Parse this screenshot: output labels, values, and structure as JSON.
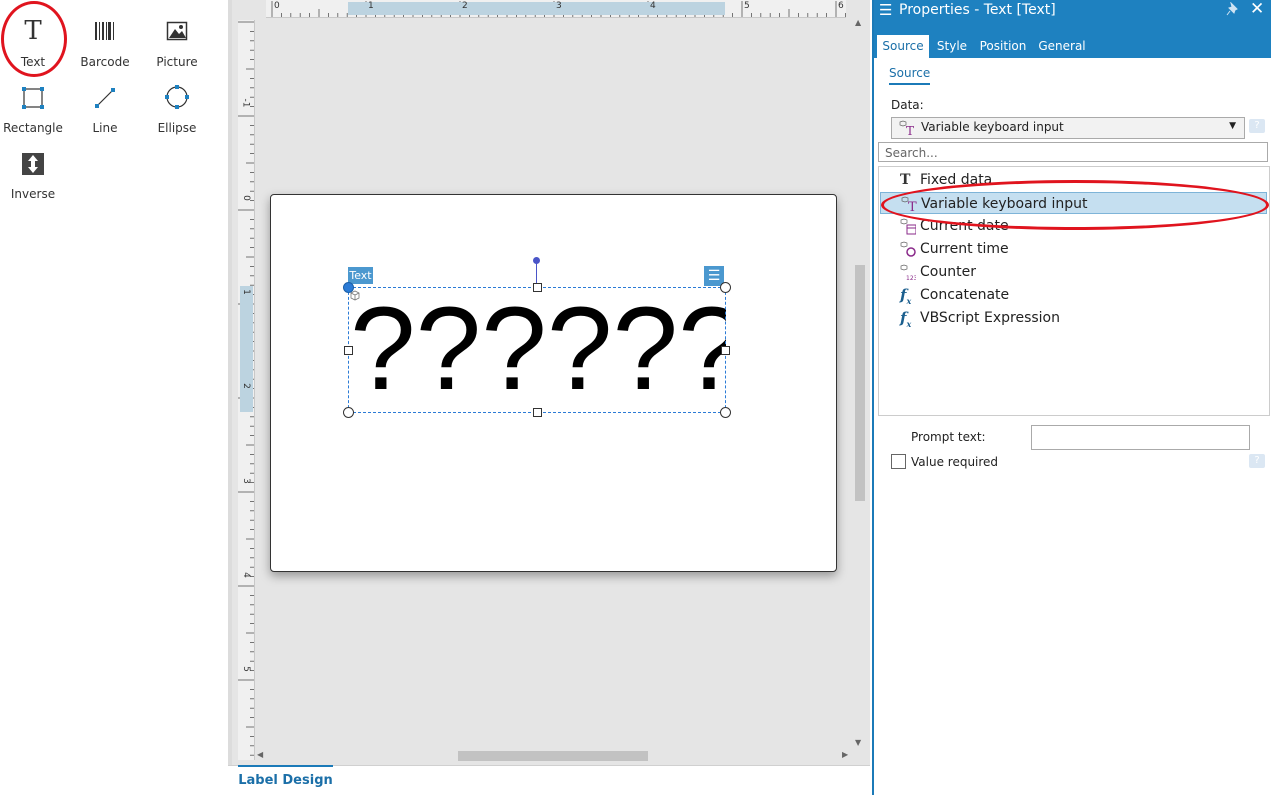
{
  "toolbox": {
    "tools": [
      {
        "label": "Text",
        "icon": "text-tool-icon"
      },
      {
        "label": "Barcode",
        "icon": "barcode-icon"
      },
      {
        "label": "Picture",
        "icon": "picture-icon"
      },
      {
        "label": "Rectangle",
        "icon": "rectangle-icon"
      },
      {
        "label": "Line",
        "icon": "line-icon"
      },
      {
        "label": "Ellipse",
        "icon": "ellipse-icon"
      },
      {
        "label": "Inverse",
        "icon": "inverse-icon"
      }
    ]
  },
  "rulers": {
    "horizontal": [
      "0",
      "1",
      "2",
      "3",
      "4",
      "5",
      "6"
    ],
    "vertical": [
      "-1",
      "0",
      "1",
      "2",
      "3",
      "4",
      "5"
    ]
  },
  "canvas": {
    "object_tag": "Text",
    "object_text": "??????",
    "menu_glyph": "☰"
  },
  "bottom_tab": "Label Design",
  "properties": {
    "title": "Properties - Text [Text]",
    "tabs": [
      "Source",
      "Style",
      "Position",
      "General"
    ],
    "subtab": "Source",
    "data_label": "Data:",
    "data_value": "Variable keyboard input",
    "search_placeholder": "Search...",
    "items": [
      {
        "label": "Fixed data",
        "icon": "fixed-data-icon"
      },
      {
        "label": "Variable keyboard input",
        "icon": "variable-icon"
      },
      {
        "label": "Current date",
        "icon": "calendar-icon"
      },
      {
        "label": "Current time",
        "icon": "clock-icon"
      },
      {
        "label": "Counter",
        "icon": "counter-icon"
      },
      {
        "label": "Concatenate",
        "icon": "function-icon"
      },
      {
        "label": "VBScript Expression",
        "icon": "function-icon"
      }
    ],
    "prompt_label": "Prompt text:",
    "prompt_value": "",
    "value_required_label": "Value required",
    "value_required_checked": false
  },
  "colors": {
    "accent": "#1e81c0",
    "selection": "#c5dff0",
    "annotation": "#e0141e"
  }
}
